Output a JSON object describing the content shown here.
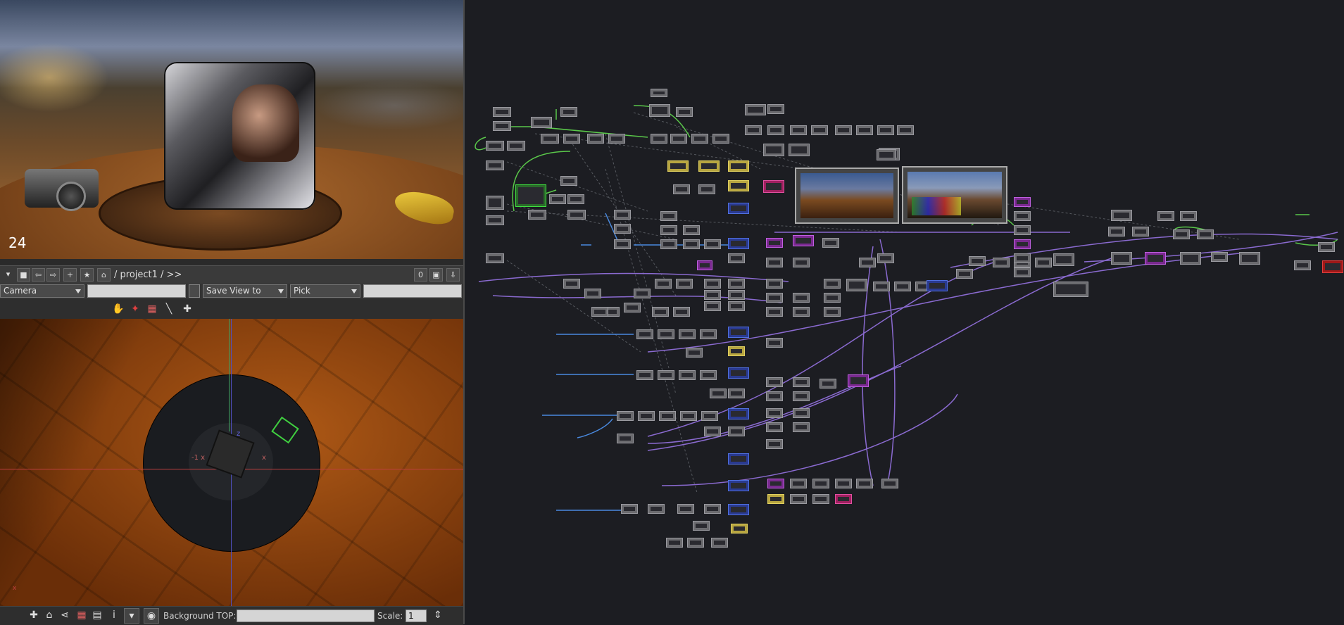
{
  "render_view": {
    "frame_number": "24"
  },
  "toolbar1": {
    "path": "/ project1 / >>",
    "counter": "0"
  },
  "toolbar2": {
    "camera_select": "Camera",
    "save_view_select": "Save View to",
    "pick_select": "Pick"
  },
  "viewport": {
    "axis_label_neg_x": "-1 x",
    "axis_label_x": "x",
    "axis_label_z": "z"
  },
  "bottom_bar": {
    "background_top_label": "Background TOP:",
    "scale_label": "Scale:",
    "scale_value": "1"
  },
  "network_editor": {
    "wire_colors": {
      "green": "#5ac84a",
      "purple": "#8a6ad0",
      "blue": "#4a8ae0",
      "dashed": "#55585e"
    },
    "node_colors": {
      "default": "#6b6b6f",
      "yellow": "#b8a640",
      "blue": "#2a3a90",
      "purple": "#7a2a90",
      "pink": "#a02060",
      "red": "#a01818"
    }
  },
  "icons": {
    "toolbar1": [
      "menu-triangle-icon",
      "stop-icon",
      "back-icon",
      "forward-icon",
      "add-icon",
      "star-icon",
      "home-icon",
      "layout-icon",
      "pin-icon"
    ],
    "toolbar3": [
      "hand-icon",
      "pin-icon",
      "grid-icon",
      "ruler-icon",
      "plus-cross-icon"
    ],
    "bottom": [
      "plus-cross-icon",
      "home-camera-icon",
      "share-icon",
      "grid-icon",
      "cube-icon",
      "info-icon",
      "dropdown-icon",
      "camera-icon",
      "move-icon"
    ]
  }
}
